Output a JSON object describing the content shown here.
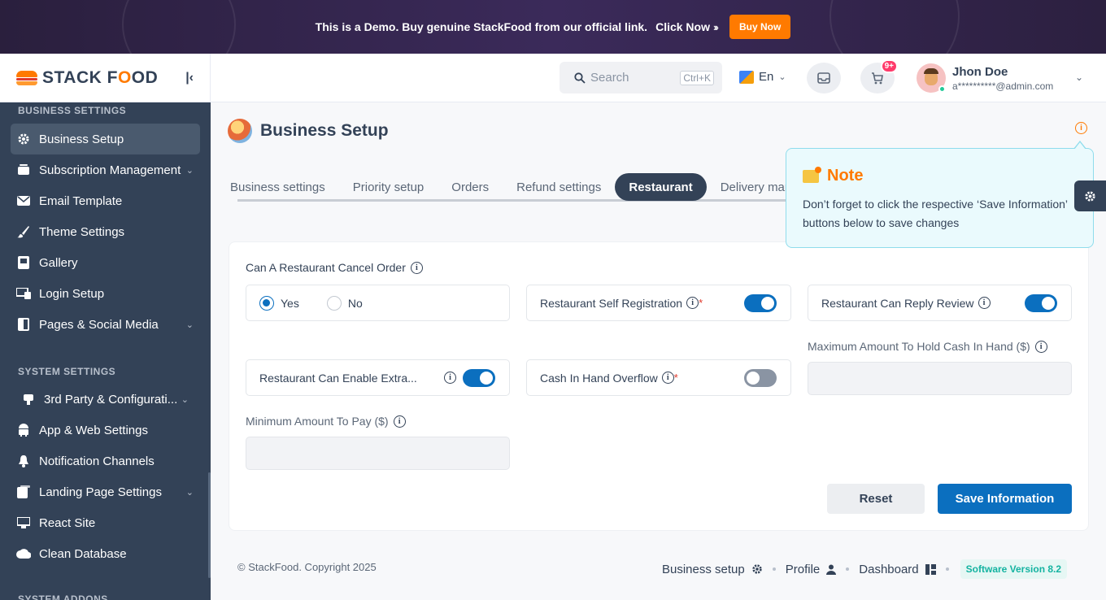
{
  "banner": {
    "text": "This is a Demo. Buy genuine StackFood from our official link.",
    "link": "Click Now",
    "arrows": "›››",
    "buy_button": "Buy Now"
  },
  "brand": {
    "name_pre": "STACK F",
    "name_o": "O",
    "name_post": "OD"
  },
  "sidebar": {
    "section_business": "BUSINESS SETTINGS",
    "items_business": [
      {
        "label": "Business Setup",
        "icon": "gear-icon",
        "active": true
      },
      {
        "label": "Subscription Management",
        "icon": "subscription-icon",
        "chevron": true
      },
      {
        "label": "Email Template",
        "icon": "mail-icon"
      },
      {
        "label": "Theme Settings",
        "icon": "brush-icon"
      },
      {
        "label": "Gallery",
        "icon": "gallery-icon"
      },
      {
        "label": "Login Setup",
        "icon": "login-icon"
      },
      {
        "label": "Pages & Social Media",
        "icon": "pages-icon",
        "chevron": true
      }
    ],
    "section_system": "SYSTEM SETTINGS",
    "items_system": [
      {
        "label": "3rd Party & Configurati...",
        "icon": "plug-icon",
        "chevron": true
      },
      {
        "label": "App & Web Settings",
        "icon": "android-icon"
      },
      {
        "label": "Notification Channels",
        "icon": "bell-icon"
      },
      {
        "label": "Landing Page Settings",
        "icon": "landing-icon",
        "chevron": true
      },
      {
        "label": "React Site",
        "icon": "react-icon"
      },
      {
        "label": "Clean Database",
        "icon": "cloud-icon"
      }
    ],
    "section_addons": "SYSTEM ADDONS"
  },
  "header": {
    "search_placeholder": "Search",
    "search_shortcut": "Ctrl+K",
    "language": "En",
    "cart_badge": "9+",
    "user_name": "Jhon Doe",
    "user_email": "a**********@admin.com"
  },
  "page": {
    "title": "Business Setup",
    "tabs": [
      "Business settings",
      "Priority setup",
      "Orders",
      "Refund settings",
      "Restaurant",
      "Delivery man"
    ],
    "active_tab": "Restaurant"
  },
  "note": {
    "title": "Note",
    "body": "Don’t forget to click the respective ‘Save Information’ buttons below to save changes"
  },
  "form": {
    "cancel_order_label": "Can A Restaurant Cancel Order",
    "cancel_yes": "Yes",
    "cancel_no": "No",
    "cancel_value": "Yes",
    "self_registration_label": "Restaurant Self Registration",
    "self_registration_on": true,
    "reply_review_label": "Restaurant Can Reply Review",
    "reply_review_on": true,
    "extra_packaging_label": "Restaurant Can Enable Extra...",
    "extra_packaging_on": true,
    "cash_overflow_label": "Cash In Hand Overflow",
    "cash_overflow_on": false,
    "max_cash_label": "Maximum Amount To Hold Cash In Hand ($)",
    "max_cash_value": "",
    "min_pay_label": "Minimum Amount To Pay ($)",
    "min_pay_value": "",
    "required_mark": "*",
    "reset_button": "Reset",
    "save_button": "Save Information"
  },
  "footer": {
    "copyright": "© StackFood. Copyright 2025",
    "link_business": "Business setup",
    "link_profile": "Profile",
    "link_dashboard": "Dashboard",
    "version": "Software Version 8.2"
  },
  "colors": {
    "sidebar": "#334257",
    "accent": "#0b6fbf",
    "brand_orange": "#ff7a00"
  }
}
